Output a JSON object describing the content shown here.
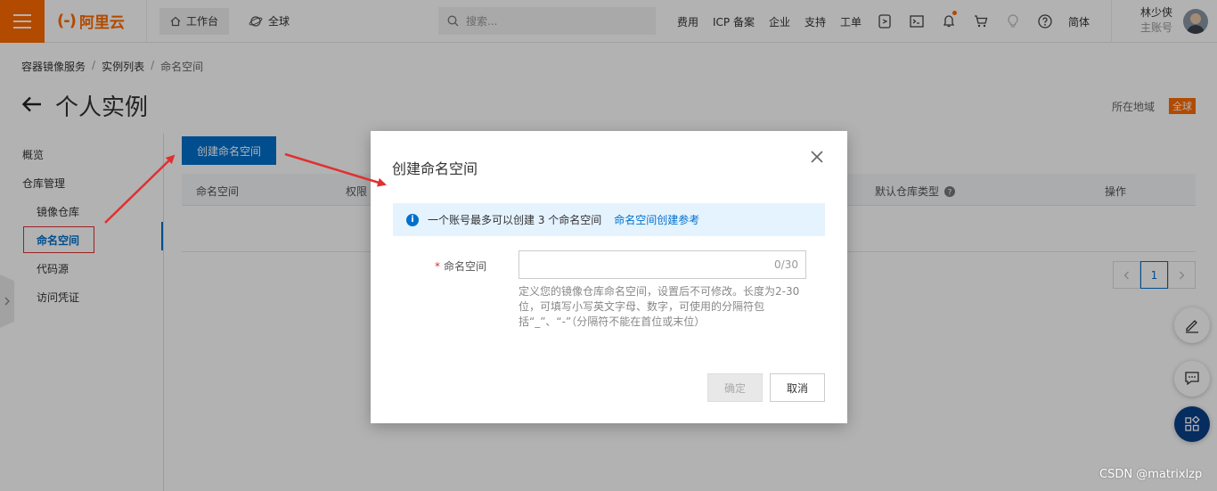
{
  "topbar": {
    "logo_text": "阿里云",
    "workbench_label": "工作台",
    "global_label": "全球",
    "search_placeholder": "搜索...",
    "links": [
      "费用",
      "ICP 备案",
      "企业",
      "支持",
      "工单"
    ],
    "lang_label": "简体",
    "user_name": "林少侠",
    "user_role": "主账号"
  },
  "breadcrumb": {
    "items": [
      "容器镜像服务",
      "实例列表",
      "命名空间"
    ]
  },
  "page": {
    "title": "个人实例",
    "region_label": "所在地域",
    "region_value": "全球"
  },
  "sidenav": {
    "overview": "概览",
    "repo_mgmt": "仓库管理",
    "image_repo": "镜像仓库",
    "namespace": "命名空间",
    "code_source": "代码源",
    "access_cred": "访问凭证"
  },
  "toolbar": {
    "create_namespace": "创建命名空间"
  },
  "table": {
    "columns": [
      "命名空间",
      "权限",
      "默认仓库类型",
      "操作"
    ]
  },
  "pager": {
    "current_page": "1"
  },
  "dialog": {
    "title": "创建命名空间",
    "notice_text": "一个账号最多可以创建 3 个命名空间",
    "notice_link": "命名空间创建参考",
    "field_label": "命名空间",
    "field_value": "",
    "field_count": "0/30",
    "help_text": "定义您的镜像仓库命名空间，设置后不可修改。长度为2-30位，可填写小写英文字母、数字，可使用的分隔符包括“_”、“-”（分隔符不能在首位或末位）",
    "ok_label": "确定",
    "cancel_label": "取消"
  },
  "watermark": "CSDN @matrixlzp",
  "colors": {
    "brand": "#ff6a00",
    "primary": "#0070cc",
    "annotation": "#e03030"
  }
}
